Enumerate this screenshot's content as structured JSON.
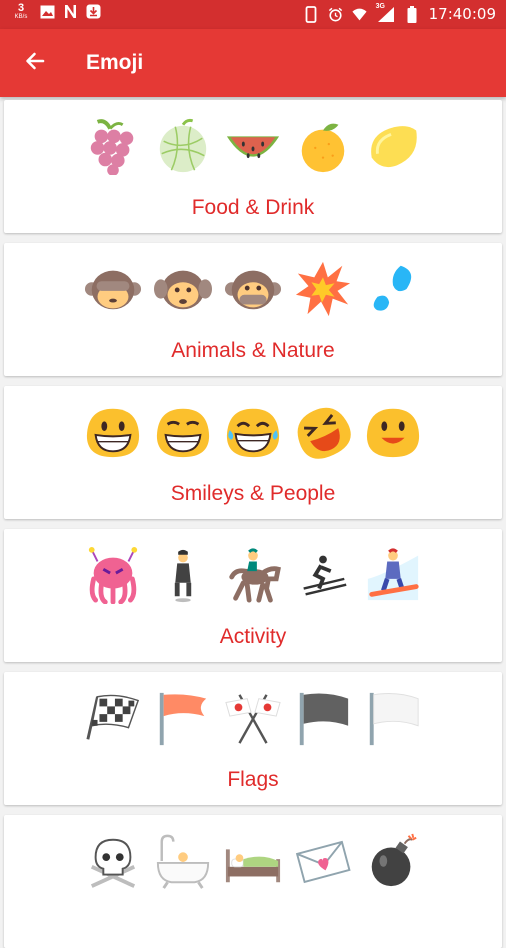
{
  "status_bar": {
    "net_speed_value": "3",
    "net_speed_unit": "KB/s",
    "time": "17:40:09",
    "network": "3G"
  },
  "app_bar": {
    "title": "Emoji"
  },
  "categories": [
    {
      "label": "Food & Drink",
      "emojis": [
        "grapes",
        "melon",
        "watermelon",
        "tangerine",
        "lemon"
      ]
    },
    {
      "label": "Animals & Nature",
      "emojis": [
        "see-no-evil-monkey",
        "hear-no-evil-monkey",
        "speak-no-evil-monkey",
        "collision",
        "sweat-droplets"
      ]
    },
    {
      "label": "Smileys & People",
      "emojis": [
        "grinning-face",
        "grimacing-face",
        "grin-sweat-face",
        "rolling-laughing-face",
        "smiling-face"
      ]
    },
    {
      "label": "Activity",
      "emojis": [
        "alien-monster",
        "levitating-man",
        "horse-racing",
        "skier",
        "snowboarder"
      ]
    },
    {
      "label": "Flags",
      "emojis": [
        "chequered-flag",
        "triangular-flag",
        "crossed-flags",
        "black-flag",
        "white-flag"
      ]
    },
    {
      "label": "",
      "emojis": [
        "skull-crossbones",
        "bathtub",
        "bed",
        "love-letter",
        "bomb"
      ]
    }
  ],
  "colors": {
    "accent": "#e53935",
    "status_bar": "#d32f2f",
    "label": "#e02b2b"
  }
}
